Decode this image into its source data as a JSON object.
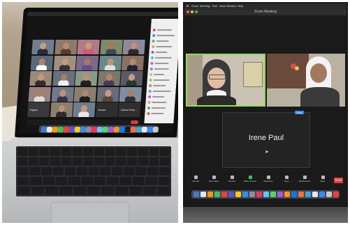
{
  "left_photo": {
    "participant_tiles": [
      {
        "name": "",
        "bg": "#6f7d8e",
        "skin": "#c79a7a",
        "cloth": "#2b2b3a"
      },
      {
        "name": "",
        "bg": "#8e7a6b",
        "skin": "#b98a6a",
        "cloth": "#5a3b2e"
      },
      {
        "name": "",
        "bg": "#b07a8a",
        "skin": "#c99b7d",
        "cloth": "#d05a78"
      },
      {
        "name": "",
        "bg": "#7b8c6a",
        "skin": "#a87a5c",
        "cloth": "#394a5a"
      },
      {
        "name": "",
        "bg": "#8a8a9a",
        "skin": "#c09070",
        "cloth": "#2a2a2a"
      },
      {
        "name": "",
        "bg": "#5a6a7a",
        "skin": "#b08468",
        "cloth": "#ffffff"
      },
      {
        "name": "",
        "bg": "#a09080",
        "skin": "#c49878",
        "cloth": "#333333"
      },
      {
        "name": "",
        "bg": "#7a6a8a",
        "skin": "#a67c5e",
        "cloth": "#6a4a8a"
      },
      {
        "name": "",
        "bg": "#6a8a8a",
        "skin": "#bf9574",
        "cloth": "#e0e0e0"
      },
      {
        "name": "",
        "bg": "#8a7060",
        "skin": "#b5896a",
        "cloth": "#222233"
      },
      {
        "name": "",
        "bg": "#9a8a7a",
        "skin": "#c39a7c",
        "cloth": "#3a2a2a"
      },
      {
        "name": "",
        "bg": "#6a7080",
        "skin": "#a97f61",
        "cloth": "#f0f0f0"
      },
      {
        "name": "",
        "bg": "#8a9a8a",
        "skin": "#be9272",
        "cloth": "#202020"
      },
      {
        "name": "",
        "bg": "#7a7a6a",
        "skin": "#b38767",
        "cloth": "#4a3a5a"
      },
      {
        "name": "",
        "bg": "#5a5a6a",
        "skin": "#c69d7f",
        "cloth": "#2a3a2a"
      },
      {
        "name": "",
        "bg": "#9a8080",
        "skin": "#ac8062",
        "cloth": "#dddddd"
      },
      {
        "name": "",
        "bg": "#707a8a",
        "skin": "#bd9373",
        "cloth": "#333344"
      },
      {
        "name": "",
        "bg": "#8a8070",
        "skin": "#b2866a",
        "cloth": "#1e1e1e"
      },
      {
        "name": "",
        "bg": "#6a6a7a",
        "skin": "#c59c7e",
        "cloth": "#584838"
      },
      {
        "name": "",
        "bg": "#7f8f9f",
        "skin": "#aa7e60",
        "cloth": "#2f2f3f"
      },
      {
        "name": "",
        "bg": "#3a3a3a",
        "skin": "",
        "cloth": ""
      },
      {
        "name": "",
        "bg": "#8d7d6d",
        "skin": "#bb9171",
        "cloth": "#2c2c2c"
      },
      {
        "name": "",
        "bg": "#6d7d8d",
        "skin": "#c29878",
        "cloth": "#e8e8e8"
      },
      {
        "name": "",
        "bg": "#2f2f2f",
        "skin": "",
        "cloth": ""
      },
      {
        "name": "",
        "bg": "#2f2f2f",
        "skin": "",
        "cloth": ""
      }
    ],
    "tile_labels": [
      "Jesusa",
      "Joshua Pulla...",
      "Pagola"
    ],
    "chat_rows": [
      {
        "color": "#e0574a",
        "w": 0.7
      },
      {
        "color": "#4a8ae0",
        "w": 0.85
      },
      {
        "color": "#5ab05a",
        "w": 0.6
      },
      {
        "color": "#e0a04a",
        "w": 0.75
      },
      {
        "color": "#a05ae0",
        "w": 0.55
      },
      {
        "color": "#4ac0c0",
        "w": 0.8
      },
      {
        "color": "#e05a9a",
        "w": 0.65
      },
      {
        "color": "#6a8ae0",
        "w": 0.7
      },
      {
        "color": "#e0c04a",
        "w": 0.5
      },
      {
        "color": "#5ae07a",
        "w": 0.75
      },
      {
        "color": "#e07a5a",
        "w": 0.6
      },
      {
        "color": "#5a9ae0",
        "w": 0.85
      },
      {
        "color": "#c05ae0",
        "w": 0.55
      },
      {
        "color": "#e0a05a",
        "w": 0.7
      },
      {
        "color": "#4ab07a",
        "w": 0.65
      },
      {
        "color": "#e05a5a",
        "w": 0.6
      }
    ],
    "dock_colors": [
      "#3a7bd5",
      "#e8e8e8",
      "#ff9500",
      "#34c759",
      "#ff3b30",
      "#5856d6",
      "#ffcc00",
      "#2d8cff",
      "#8e8e93",
      "#ff2d55",
      "#5ac8fa",
      "#4cd964",
      "#af52de",
      "#ff9500",
      "#007aff",
      "#1c1c1e",
      "#ff6b35",
      "#34aadc",
      "#e5e5ea",
      "#2d8cff",
      "#c7c7cc"
    ],
    "colors": {
      "screen": "#141414",
      "chassis": "#c9cacc",
      "keyboard_well": "#2a2a2c",
      "sidebar": "#efefef"
    }
  },
  "right_photo": {
    "menu_items": [
      "Zoom",
      "Meeting",
      "Edit",
      "View",
      "Window",
      "Help"
    ],
    "window_title": "Zoom Meeting",
    "active_speaker_name": "Irene Paul",
    "toolbar_labels": [
      "Unmute",
      "Stop Video",
      "Security",
      "Share Screen",
      "Reactions",
      "Apps",
      "Whiteboards",
      "More"
    ],
    "end_button_label": "End",
    "view_label": "View",
    "dock_colors": [
      "#3a7bd5",
      "#e8e8e8",
      "#ff9500",
      "#34c759",
      "#ff3b30",
      "#5856d6",
      "#ffcc00",
      "#2d8cff",
      "#8e8e93",
      "#ff2d55",
      "#5ac8fa",
      "#4cd964",
      "#af52de",
      "#ff9500",
      "#007aff",
      "#ff6b35",
      "#34aadc",
      "#e5e5ea",
      "#2d8cff",
      "#c7c7cc",
      "#ff3b30"
    ],
    "colors": {
      "screen": "#1a1a1a",
      "tile_border": "#8fe04a",
      "habit": "#3a3a3a",
      "veil_white": "#f2f2f2",
      "room": "#c9c2b5",
      "altar": "#6a4a3a",
      "end_red": "#e53935"
    }
  }
}
